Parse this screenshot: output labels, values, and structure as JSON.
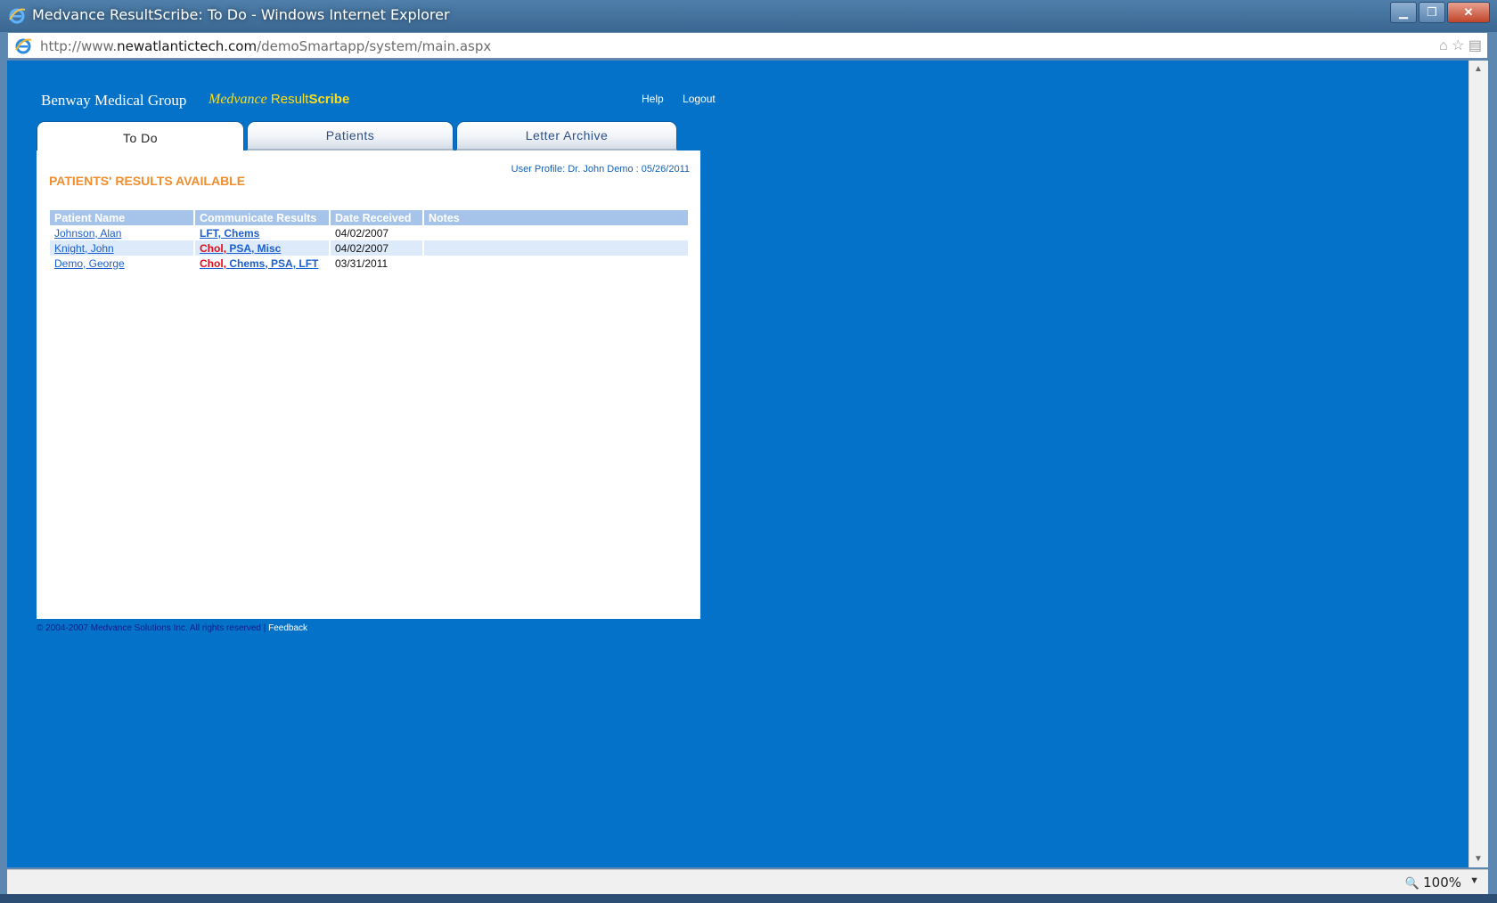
{
  "window": {
    "title": "Medvance ResultScribe: To Do - Windows Internet Explorer",
    "url_prefix": "http://www.",
    "url_domain": "newatlantictech.com",
    "url_path": "/demoSmartapp/system/main.aspx",
    "zoom": "100%"
  },
  "header": {
    "brand": "Benway Medical Group",
    "product_italic": "Medvance",
    "product_result": "Result",
    "product_scribe": "Scribe",
    "help": "Help",
    "logout": "Logout"
  },
  "tabs": [
    {
      "label": "To Do",
      "active": true
    },
    {
      "label": "Patients",
      "active": false
    },
    {
      "label": "Letter Archive",
      "active": false
    }
  ],
  "main": {
    "user_profile": "User Profile: Dr. John Demo : 05/26/2011",
    "heading": "PATIENTS' RESULTS AVAILABLE",
    "columns": [
      "Patient Name",
      "Communicate Results",
      "Date Received",
      "Notes"
    ],
    "rows": [
      {
        "patient": "Johnson, Alan",
        "results_red": "",
        "results_blue": "LFT, Chems",
        "date": "04/02/2007",
        "notes": ""
      },
      {
        "patient": "Knight, John",
        "results_red": "Chol,",
        "results_blue": " PSA, Misc",
        "date": "04/02/2007",
        "notes": ""
      },
      {
        "patient": "Demo, George",
        "results_red": "Chol,",
        "results_blue": " Chems, PSA, LFT",
        "date": "03/31/2011",
        "notes": ""
      }
    ]
  },
  "footer": {
    "copyright": "© 2004-2007 Medvance Solutions Inc. All rights reserved | ",
    "feedback": "Feedback"
  },
  "colors": {
    "page_bg": "#0572c9",
    "header_accent": "#ffde16",
    "heading_orange": "#f28d2c",
    "table_header": "#a6c4ea",
    "urgent_red": "#e30b17"
  }
}
